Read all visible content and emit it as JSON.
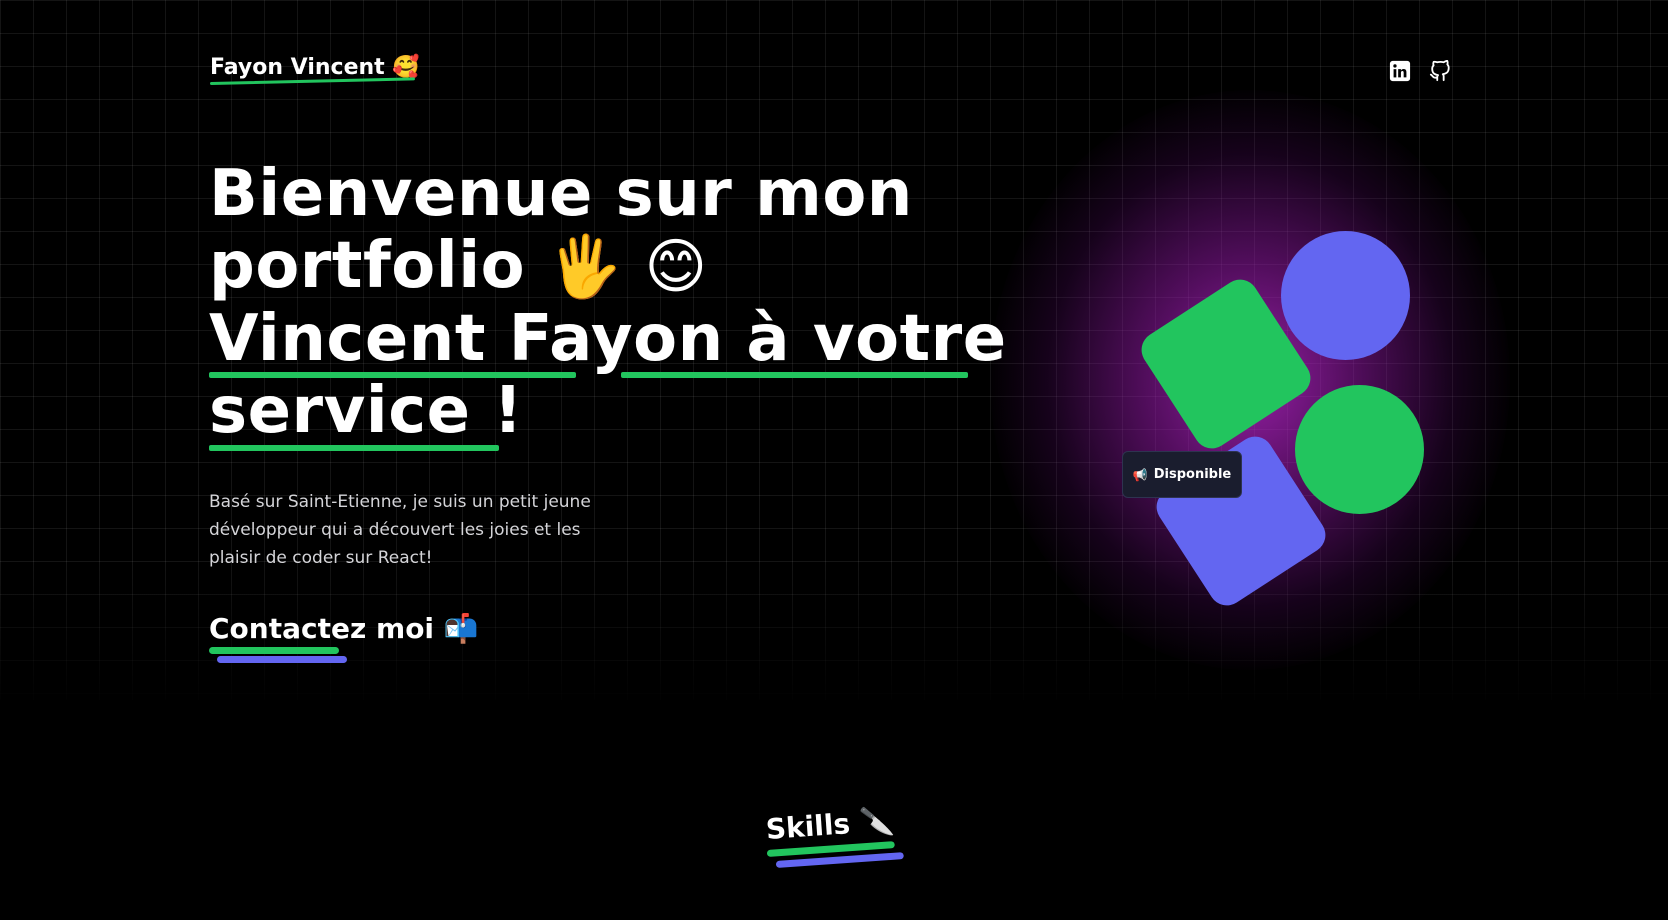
{
  "header": {
    "logo_text": "Fayon Vincent",
    "logo_emoji": "🥰",
    "social": [
      {
        "icon": "linkedin-icon",
        "label": "LinkedIn"
      },
      {
        "icon": "github-icon",
        "label": "GitHub"
      }
    ]
  },
  "hero": {
    "title_line1": "Bienvenue sur mon",
    "title_line2": "portfolio",
    "title_line2_emojis": "🖐️ 😊",
    "title_line3": "Vincent Fayon à votre",
    "title_line4": "service !",
    "description": "Basé sur Saint-Etienne, je suis un petit jeune développeur qui a découvert les joies et les plaisir de coder sur React!",
    "contact_label": "Contactez moi",
    "contact_emoji": "📬",
    "badge_icon": "📢",
    "badge_label": "Disponible"
  },
  "skills": {
    "title": "Skills",
    "emoji": "🔪"
  },
  "colors": {
    "background": "#000000",
    "accent_green": "#22c55e",
    "accent_purple": "#6366f1",
    "glow": "#be28d2",
    "badge_bg": "#1a1d2e"
  }
}
